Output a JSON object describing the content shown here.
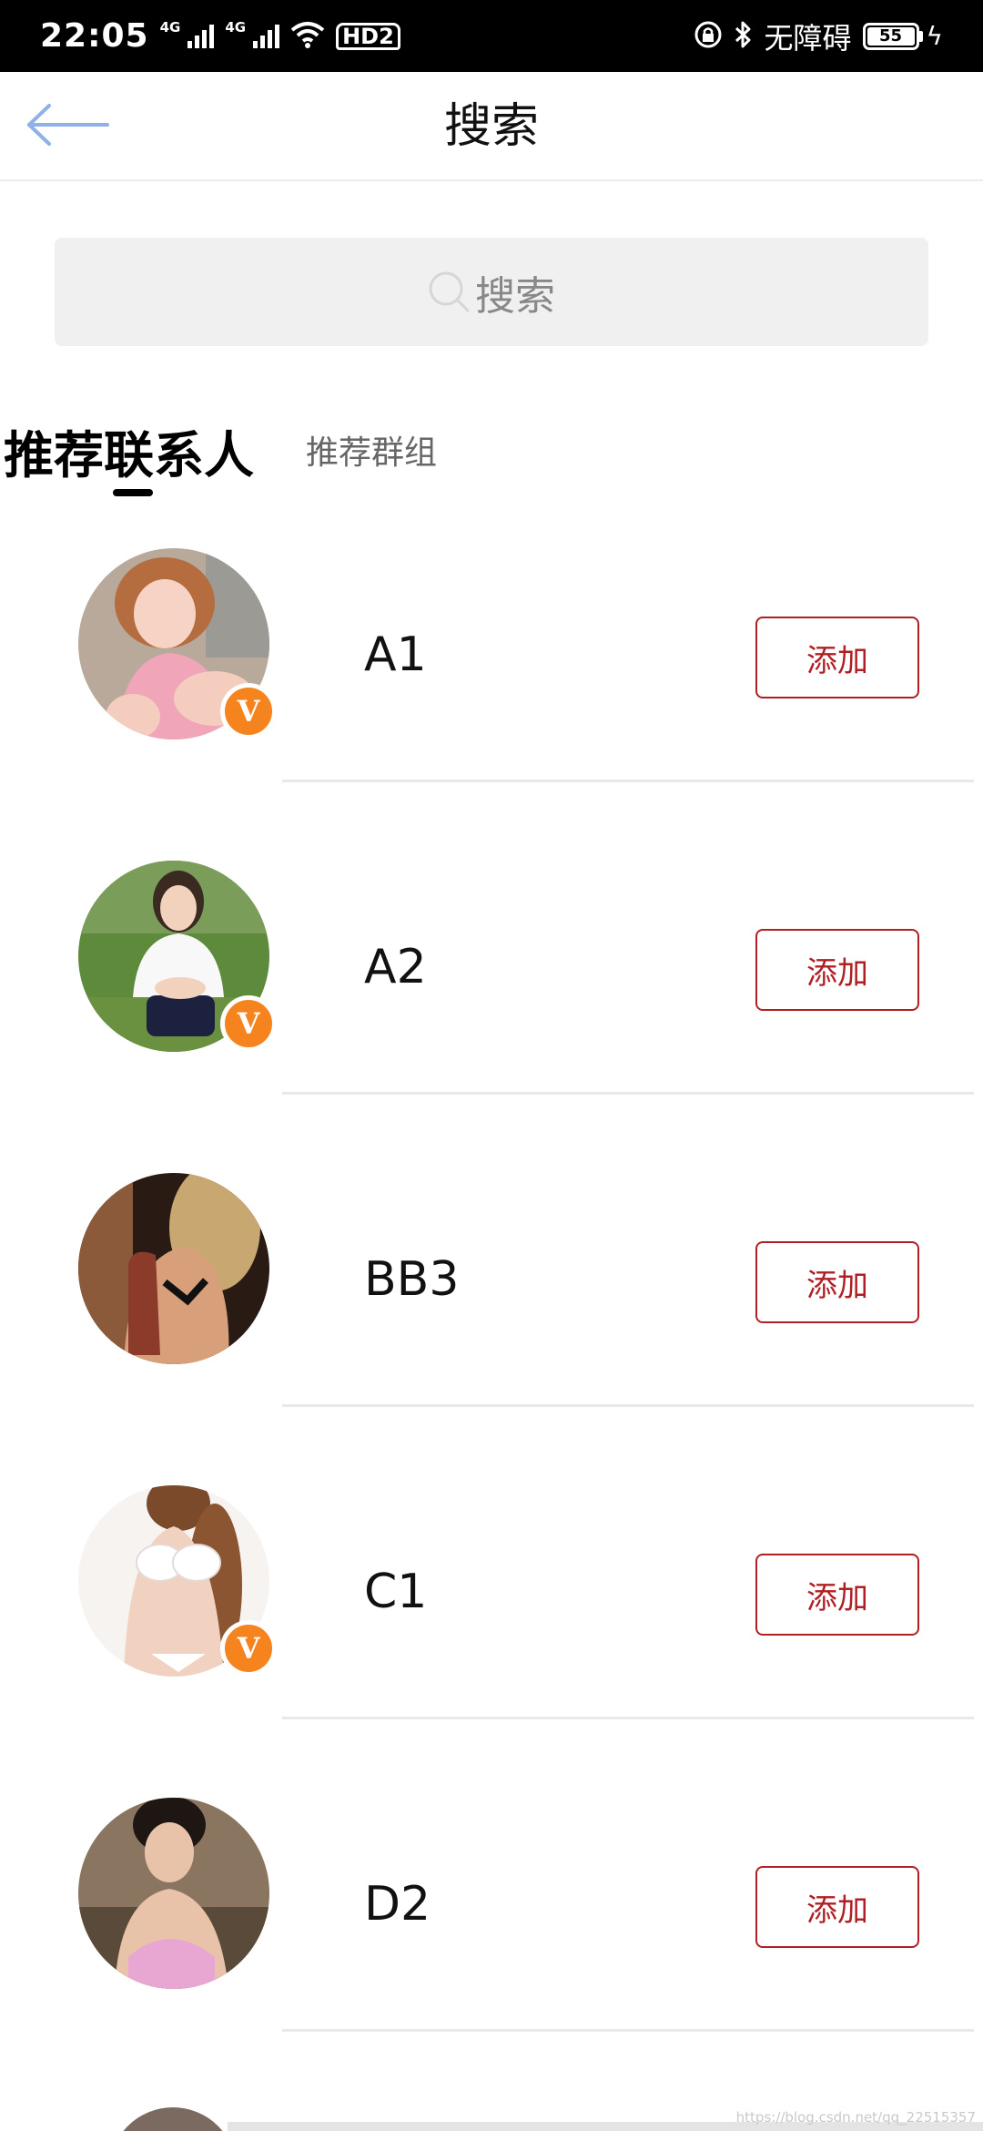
{
  "status_bar": {
    "time": "22:05",
    "network_1": "4G",
    "network_2": "4G",
    "hd_label": "HD2",
    "accessibility_text": "无障碍",
    "battery_level": "55"
  },
  "nav": {
    "title": "搜索"
  },
  "search": {
    "placeholder": "搜索"
  },
  "tabs": [
    {
      "label": "推荐联系人",
      "active": true
    },
    {
      "label": "推荐群组",
      "active": false
    }
  ],
  "contacts": [
    {
      "name": "A1",
      "verified": true,
      "add_label": "添加"
    },
    {
      "name": "A2",
      "verified": true,
      "add_label": "添加"
    },
    {
      "name": "BB3",
      "verified": false,
      "add_label": "添加"
    },
    {
      "name": "C1",
      "verified": true,
      "add_label": "添加"
    },
    {
      "name": "D2",
      "verified": false,
      "add_label": "添加"
    }
  ],
  "badge_letter": "V",
  "colors": {
    "accent_red": "#b01f24",
    "badge_orange": "#f5841f",
    "back_arrow_blue": "#8fb1e8"
  },
  "watermark": "https://blog.csdn.net/qq_22515357"
}
